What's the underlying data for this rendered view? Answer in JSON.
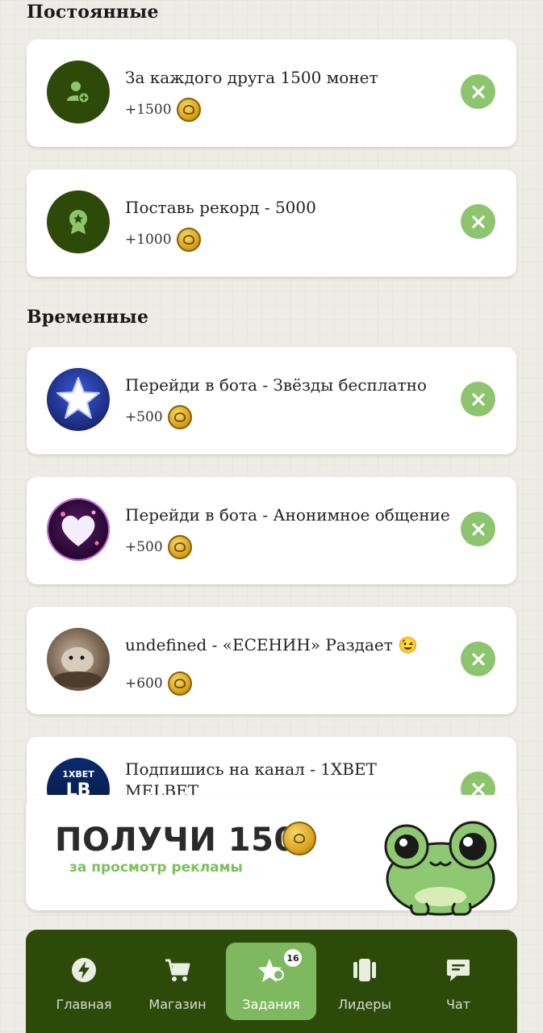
{
  "sections": {
    "permanent": "Постоянные",
    "temporary": "Временные"
  },
  "tasks": [
    {
      "title": "За каждого друга 1500 монет",
      "reward": "+1500",
      "icon": "add-user-icon"
    },
    {
      "title": "Поставь рекорд - 5000",
      "reward": "+1000",
      "icon": "award-ribbon-icon"
    },
    {
      "title": "Перейди в бота - Звёзды бесплатно",
      "reward": "+500",
      "icon": "star-bot-avatar"
    },
    {
      "title": "Перейди в бота - Анонимное общение",
      "reward": "+500",
      "icon": "heart-bot-avatar"
    },
    {
      "title": "undefined - «ЕСЕНИН» Раздает 😉",
      "reward": "+600",
      "icon": "hamster-photo-avatar"
    },
    {
      "title_line1": "Подпишись на канал - 1XBET",
      "title_line2": "MELBET",
      "icon": "1xbet-logo-avatar",
      "logo_text": "1XBET",
      "logo_sub": "LB"
    }
  ],
  "banner": {
    "title": "ПОЛУЧИ 150",
    "subtitle": "за просмотр рекламы",
    "mascot": "frog-mascot"
  },
  "nav": {
    "items": [
      {
        "label": "Главная",
        "icon": "lightning-icon"
      },
      {
        "label": "Магазин",
        "icon": "cart-icon"
      },
      {
        "label": "Задания",
        "icon": "star-tasks-icon",
        "active": true,
        "badge": "16"
      },
      {
        "label": "Лидеры",
        "icon": "cards-icon"
      },
      {
        "label": "Чат",
        "icon": "chat-icon"
      }
    ]
  },
  "colors": {
    "accent_green": "#8dc56f",
    "dark_green": "#2e4a0b",
    "background": "#eeece6"
  }
}
